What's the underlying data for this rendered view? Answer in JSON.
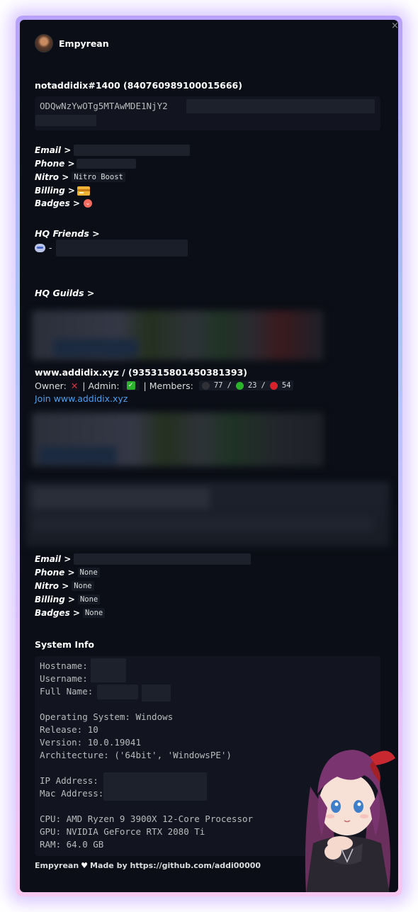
{
  "embed": {
    "author_name": "Empyrean",
    "account_title": "notaddidix#1400 (840760989100015666)",
    "token_prefix": "ODQwNzYwOTg5MTAwMDE1NjY2",
    "close_glyph": "×"
  },
  "account": {
    "email_label": "Email >",
    "phone_label": "Phone >",
    "nitro_label": "Nitro >",
    "nitro_value": "Nitro Boost",
    "billing_label": "Billing >",
    "billing_icon": "credit-card-icon",
    "badges_label": "Badges >",
    "badges_icon": "heart-badge-icon"
  },
  "friends": {
    "title": "HQ Friends >",
    "separator": "-"
  },
  "guilds": {
    "title": "HQ Guilds >",
    "guild_name": "www.addidix.xyz / (935315801450381393)",
    "owner_label": "Owner:",
    "owner_value": "✕",
    "admin_label": "| Admin:",
    "admin_value": "✓",
    "members_label": "| Members:",
    "members_offline": "77",
    "members_online": "23",
    "members_dnd": "54",
    "slash": "/",
    "join_link": "Join www.addidix.xyz",
    "colors": {
      "offline": "#2f3136",
      "online": "#2bb52b",
      "dnd": "#d9232c",
      "owner_x": "#e0333c",
      "admin_check": "#2bb52b",
      "link": "#4f9ff0"
    }
  },
  "account2": {
    "email_label": "Email >",
    "phone_label": "Phone >",
    "phone_value": "None",
    "nitro_label": "Nitro >",
    "nitro_value": "None",
    "billing_label": "Billing >",
    "billing_value": "None",
    "badges_label": "Badges >",
    "badges_value": "None"
  },
  "system": {
    "title": "System Info",
    "hostname_label": "Hostname:",
    "username_label": "Username:",
    "fullname_label": "Full Name:",
    "os": "Operating System: Windows",
    "release": "Release: 10",
    "version": "Version: 10.0.19041",
    "arch": "Architecture: ('64bit', 'WindowsPE')",
    "ip_label": "IP Address:",
    "mac_label": "Mac Address:",
    "cpu": "CPU: AMD Ryzen 9 3900X 12-Core Processor",
    "gpu": "GPU: NVIDIA GeForce RTX 2080 Ti",
    "ram": "RAM: 64.0 GB"
  },
  "footer": {
    "brand": "Empyrean",
    "heart": "♥",
    "credit": "Made by https://github.com/addi00000"
  }
}
